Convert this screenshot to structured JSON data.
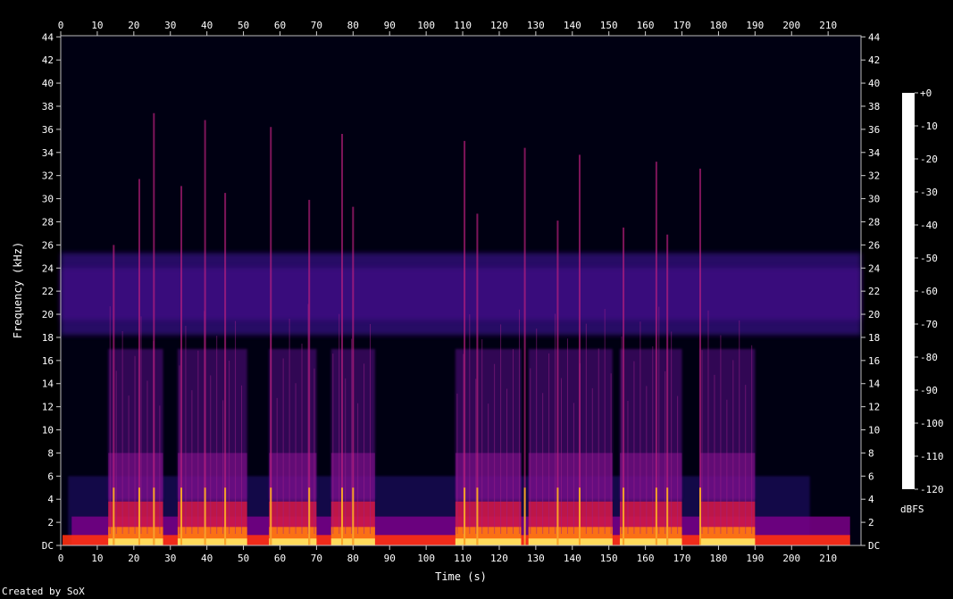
{
  "page": {
    "title_partial": "",
    "credit": "Created by SoX"
  },
  "chart_data": {
    "type": "heatmap",
    "title": "",
    "xlabel": "Time (s)",
    "ylabel": "Frequency (kHz)",
    "xlim": [
      0,
      219
    ],
    "ylim": [
      0,
      44.1
    ],
    "x_ticks": [
      0,
      10,
      20,
      30,
      40,
      50,
      60,
      70,
      80,
      90,
      100,
      110,
      120,
      130,
      140,
      150,
      160,
      170,
      180,
      190,
      200,
      210
    ],
    "y_ticks": [
      "DC",
      "2",
      "4",
      "6",
      "8",
      "10",
      "12",
      "14",
      "16",
      "18",
      "20",
      "22",
      "24",
      "26",
      "28",
      "30",
      "32",
      "34",
      "36",
      "38",
      "40",
      "42",
      "44"
    ],
    "colorbar": {
      "label": "dBFS",
      "ticks": [
        "+0",
        "-10",
        "-20",
        "-30",
        "-40",
        "-50",
        "-60",
        "-70",
        "-80",
        "-90",
        "-100",
        "-110",
        "-120"
      ],
      "colors": [
        "#ffffff",
        "#ffff80",
        "#ffd000",
        "#ff8000",
        "#ff2000",
        "#e00040",
        "#b00070",
        "#8000a0",
        "#5000a0",
        "#300080",
        "#100040",
        "#000018"
      ]
    },
    "noise_band_khz": [
      18.2,
      25.3
    ],
    "activity_segments_s": [
      [
        13,
        28
      ],
      [
        32,
        51
      ],
      [
        57,
        70
      ],
      [
        74,
        86
      ],
      [
        108,
        126
      ],
      [
        128,
        151
      ],
      [
        153,
        170
      ],
      [
        175,
        190
      ]
    ],
    "transient_peaks_s": [
      14.5,
      21.5,
      25.5,
      33,
      39.5,
      45,
      57.5,
      68,
      77,
      80,
      110.5,
      114,
      127,
      136,
      142,
      154,
      163,
      166,
      175
    ]
  }
}
